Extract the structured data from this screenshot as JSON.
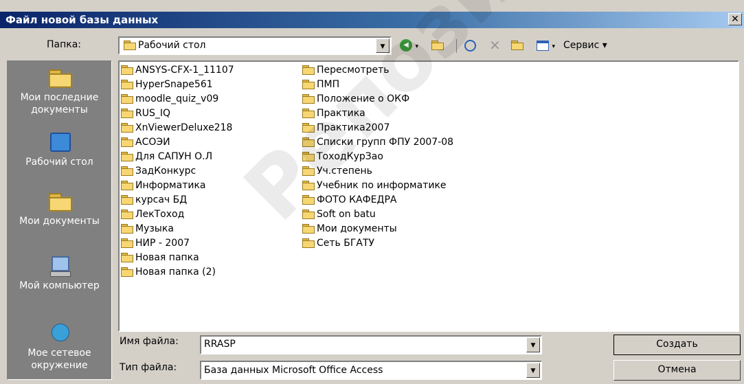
{
  "window": {
    "title": "Файл новой базы данных",
    "close": "✕"
  },
  "folder_bar": {
    "label": "Папка:",
    "current": "Рабочий стол"
  },
  "toolbar": {
    "back": "◀",
    "service": "Сервис ▾"
  },
  "places": [
    {
      "label": "Мои последние документы",
      "icon": "recent-docs"
    },
    {
      "label": "Рабочий стол",
      "icon": "desktop"
    },
    {
      "label": "Мои документы",
      "icon": "my-documents"
    },
    {
      "label": "Мой компьютер",
      "icon": "my-computer"
    },
    {
      "label": "Мое сетевое окружение",
      "icon": "network"
    }
  ],
  "files_col1": [
    "ANSYS-CFX-1_11107",
    "HyperSnape561",
    "moodle_quiz_v09",
    "RUS_IQ",
    "XnViewerDeluxe218",
    "АСОЭИ",
    "Для САПУН О.Л",
    "ЗадКонкурс",
    "Информатика",
    "курсач БД",
    "ЛекТоход",
    "Музыка",
    "НИР - 2007",
    "Новая папка",
    "Новая папка (2)"
  ],
  "files_col2": [
    "Пересмотреть",
    "ПМП",
    "Положение о ОКФ",
    "Практика",
    "Практика2007",
    "Списки групп ФПУ 2007-08",
    "ТоходКурЗао",
    "Уч.степень",
    "Учебник по информатике",
    "ФОТО КАФЕДРА",
    "Soft on batu",
    "Мои документы",
    "Сеть БГАТУ"
  ],
  "filename": {
    "label": "Имя файла:",
    "value": "RRASP"
  },
  "filetype": {
    "label": "Тип файла:",
    "value": "База данных Microsoft Office Access"
  },
  "buttons": {
    "create": "Создать",
    "cancel": "Отмена"
  },
  "watermark": "Репозиторий БГАТУ",
  "colors": {
    "titlebar": "#0a246a",
    "face": "#d4d0c8",
    "places_bg": "#808080"
  }
}
